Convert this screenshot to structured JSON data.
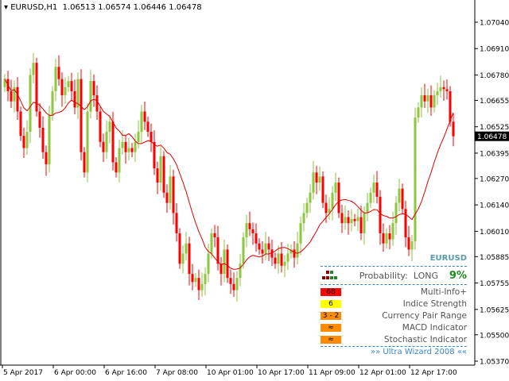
{
  "header": {
    "symbol": "EURUSD,H1",
    "open": "1.06513",
    "high": "1.06574",
    "low": "1.06446",
    "close": "1.06478"
  },
  "colors": {
    "bull": "#8dc63f",
    "bear": "#ff0000",
    "ma": "#e00000",
    "axis": "#000000"
  },
  "chart_data": {
    "type": "candlestick",
    "ylim": [
      1.0537,
      1.0711
    ],
    "current_price": "1.06478",
    "y_ticks": [
      "1.07040",
      "1.06910",
      "1.06780",
      "1.06655",
      "1.06525",
      "1.06395",
      "1.06270",
      "1.06140",
      "1.06010",
      "1.05885",
      "1.05755",
      "1.05625",
      "1.05500",
      "1.05370"
    ],
    "x_ticks": [
      "5 Apr 2017",
      "6 Apr 00:00",
      "6 Apr 16:00",
      "7 Apr 08:00",
      "10 Apr 01:00",
      "10 Apr 17:00",
      "11 Apr 09:00",
      "12 Apr 01:00",
      "12 Apr 17:00"
    ],
    "first_open": 1.0672,
    "closes": [
      1.0676,
      1.067,
      1.0665,
      1.0672,
      1.066,
      1.0648,
      1.0642,
      1.065,
      1.0678,
      1.0684,
      1.066,
      1.0652,
      1.064,
      1.0634,
      1.0658,
      1.067,
      1.0682,
      1.0676,
      1.0668,
      1.0672,
      1.0675,
      1.067,
      1.0662,
      1.0676,
      1.064,
      1.063,
      1.066,
      1.0675,
      1.0668,
      1.066,
      1.0645,
      1.064,
      1.065,
      1.0655,
      1.0635,
      1.063,
      1.0642,
      1.0645,
      1.064,
      1.0642,
      1.064,
      1.0645,
      1.065,
      1.066,
      1.0655,
      1.065,
      1.0645,
      1.0632,
      1.0625,
      1.0638,
      1.062,
      1.0615,
      1.0628,
      1.061,
      1.06,
      1.0585,
      1.059,
      1.0595,
      1.058,
      1.0576,
      1.0578,
      1.0572,
      1.0575,
      1.058,
      1.059,
      1.06,
      1.0598,
      1.0585,
      1.058,
      1.0592,
      1.0578,
      1.0575,
      1.0572,
      1.0578,
      1.0585,
      1.0598,
      1.0605,
      1.0602,
      1.06,
      1.0595,
      1.0592,
      1.059,
      1.0595,
      1.0592,
      1.0588,
      1.0585,
      1.059,
      1.0584,
      1.0586,
      1.059,
      1.0592,
      1.0588,
      1.0595,
      1.0605,
      1.061,
      1.0615,
      1.062,
      1.063,
      1.0625,
      1.0628,
      1.0615,
      1.061,
      1.0612,
      1.062,
      1.0625,
      1.061,
      1.0605,
      1.0608,
      1.0605,
      1.0607,
      1.0606,
      1.0608,
      1.06,
      1.061,
      1.0615,
      1.062,
      1.0625,
      1.0618,
      1.06,
      1.0595,
      1.06,
      1.0597,
      1.0605,
      1.0615,
      1.0622,
      1.0612,
      1.0598,
      1.0592,
      1.0596,
      1.0657,
      1.0662,
      1.0668,
      1.0665,
      1.0668,
      1.0662,
      1.0668,
      1.067,
      1.0672,
      1.0671,
      1.067,
      1.0655,
      1.06478
    ]
  },
  "panel": {
    "pair": "EURUSD",
    "probability_label": "Probability:",
    "direction": "LONG",
    "probability": "9%",
    "rows": [
      {
        "badge": "68",
        "label": "Multi-Info+",
        "color": "#ff0000"
      },
      {
        "badge": "6",
        "label": "Indice Strength",
        "color": "#ffff00"
      },
      {
        "badge": "3 - 2",
        "label": "Currency Pair Range",
        "color": "#ff8c00"
      },
      {
        "badge": "≈",
        "label": "MACD Indicator",
        "color": "#ff8c00"
      },
      {
        "badge": "≈",
        "label": "Stochastic Indicator",
        "color": "#ff8c00"
      }
    ],
    "footer": "»» Ultra Wizard 2008 ««"
  }
}
